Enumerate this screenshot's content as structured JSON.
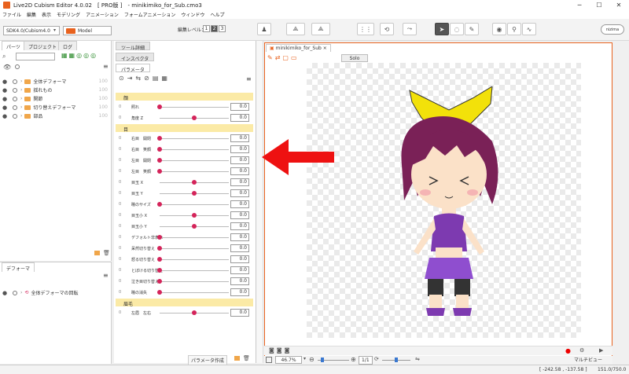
{
  "window": {
    "title": "Live2D Cubism Editor 4.0.02　[ PRO版 ]　- minikimiko_for_Sub.cmo3",
    "minimize": "─",
    "maximize": "☐",
    "close": "✕"
  },
  "menu": [
    "ファイル",
    "編集",
    "表示",
    "モデリング",
    "アニメーション",
    "フォームアニメーション",
    "ウィンドウ",
    "ヘルプ"
  ],
  "toolbar": {
    "sdk_select": "SDK4.0/Cubism4.0",
    "mode_select": "Model",
    "edit_level_label": "編集レベル：",
    "edit_levels": [
      "1",
      "2",
      "3"
    ],
    "brand_badge": "nizima"
  },
  "left_panel": {
    "tabs": [
      "パーツ",
      "プロジェクト",
      "ログ"
    ],
    "parts": [
      {
        "label": "全体デフォーマ",
        "value": "100"
      },
      {
        "label": "揺れもの",
        "value": "100"
      },
      {
        "label": "関節",
        "value": "100"
      },
      {
        "label": "切り替えデフォーマ",
        "value": "100"
      },
      {
        "label": "部品",
        "value": "100"
      }
    ],
    "deformer_tab": "デフォーマ",
    "deformer_item": "全体デフォーマの回転"
  },
  "param_panel": {
    "tabs": [
      "ツール詳細",
      "インスペクタ",
      "パラメータ"
    ],
    "groups": [
      {
        "name": "顔",
        "params": [
          {
            "name": "照れ",
            "value": "0.0",
            "pos": 0.0
          },
          {
            "name": "角度 Z",
            "value": "0.0",
            "pos": 0.5
          }
        ]
      },
      {
        "name": "目",
        "params": [
          {
            "name": "右目　開閉",
            "value": "0.0",
            "pos": 0.0
          },
          {
            "name": "右目　笑顔",
            "value": "0.0",
            "pos": 0.0
          },
          {
            "name": "左目　開閉",
            "value": "0.0",
            "pos": 0.0
          },
          {
            "name": "左目　笑顔",
            "value": "0.0",
            "pos": 0.0
          },
          {
            "name": "目玉 X",
            "value": "0.0",
            "pos": 0.5
          },
          {
            "name": "目玉 Y",
            "value": "0.0",
            "pos": 0.5
          },
          {
            "name": "瞳のサイズ",
            "value": "0.0",
            "pos": 0.0
          },
          {
            "name": "目玉小 X",
            "value": "0.0",
            "pos": 0.5
          },
          {
            "name": "目玉小 Y",
            "value": "0.0",
            "pos": 0.5
          },
          {
            "name": "デフォルト非表示",
            "value": "0.0",
            "pos": 0.0
          },
          {
            "name": "呆然切り替え",
            "value": "0.0",
            "pos": 0.0
          },
          {
            "name": "怒る切り替え",
            "value": "0.0",
            "pos": 0.0
          },
          {
            "name": "とぼける切り替え",
            "value": "0.0",
            "pos": 0.0
          },
          {
            "name": "泣き目切り替え",
            "value": "0.0",
            "pos": 0.0
          },
          {
            "name": "瞳の消失",
            "value": "0.0",
            "pos": 0.0
          }
        ]
      },
      {
        "name": "眉毛",
        "params": [
          {
            "name": "左眉　左右",
            "value": "0.0",
            "pos": 0.5
          }
        ]
      }
    ],
    "create_button": "パラメータ作成"
  },
  "viewport": {
    "tab": "minikimiko_for_Sub",
    "solo_button": "Solo",
    "zoom": "46.7%",
    "frame": "1/1",
    "multiview": "マルチビュー"
  },
  "status": {
    "coords": "[ -242.58 , -137.58 ]",
    "scale": "151.0/750.0"
  },
  "annotation_color": "#ee1111"
}
